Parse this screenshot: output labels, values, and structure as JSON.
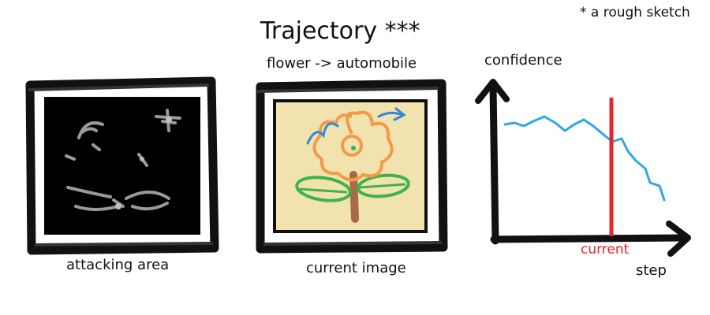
{
  "title": "Trajectory ***",
  "note": "* a rough sketch",
  "subtitle": "flower -> automobile",
  "panels": {
    "attacking_area_caption": "attacking area",
    "current_image_caption": "current image"
  },
  "plot": {
    "y_label": "confidence",
    "x_label": "step",
    "marker_label": "current"
  },
  "colors": {
    "frame": "#111111",
    "curve": "#2fa6e8",
    "marker": "#e8242a",
    "image_bg": "#f2e2ad",
    "petal": "#f39a4a",
    "leaf": "#3cb44a",
    "stem": "#a86a4a",
    "dark_panel": "#000000"
  }
}
